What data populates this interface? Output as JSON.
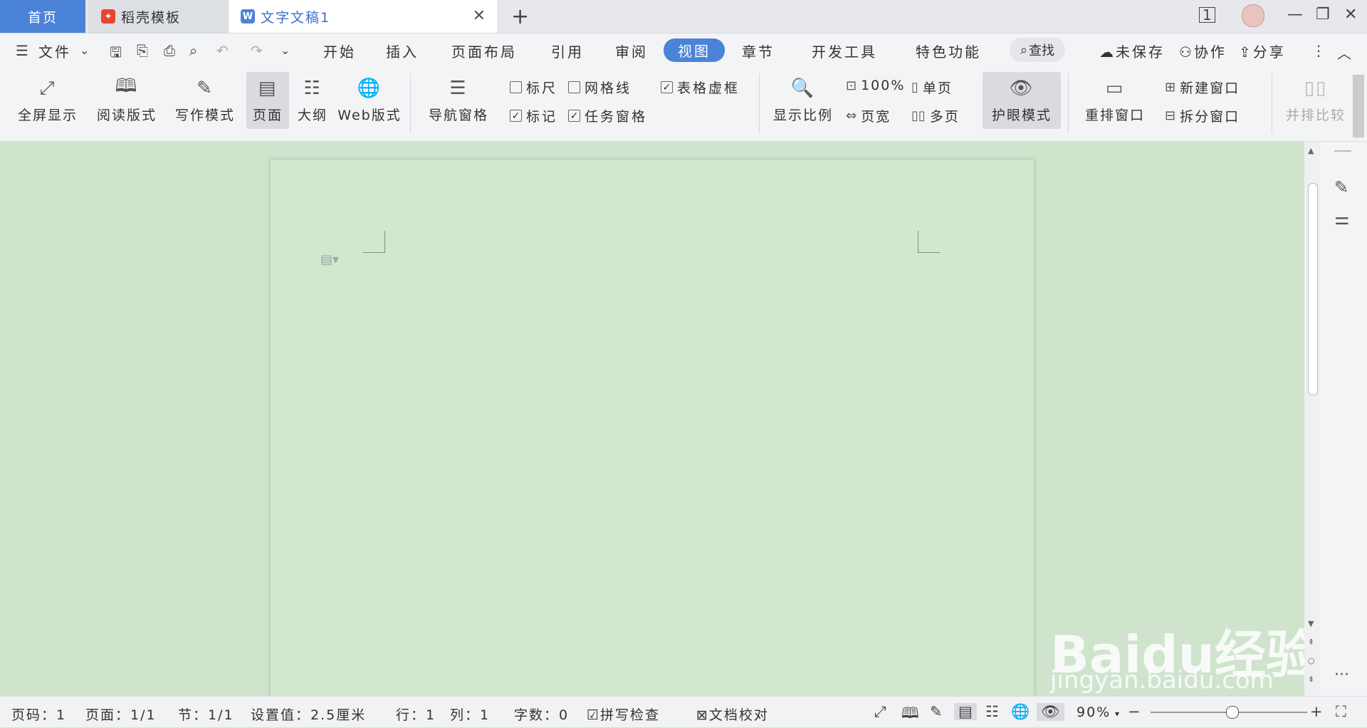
{
  "tabs": {
    "home": "首页",
    "template": "稻壳模板",
    "document": "文字文稿1"
  },
  "menu": {
    "file": "文件",
    "items": [
      "开始",
      "插入",
      "页面布局",
      "引用",
      "审阅",
      "视图",
      "章节",
      "开发工具",
      "特色功能"
    ],
    "active": "视图",
    "search": "查找",
    "unsaved": "未保存",
    "collab": "协作",
    "share": "分享"
  },
  "ribbon": {
    "fullscreen": "全屏显示",
    "reading": "阅读版式",
    "writing": "写作模式",
    "page": "页面",
    "outline": "大纲",
    "web": "Web版式",
    "nav_pane": "导航窗格",
    "ruler": "标尺",
    "gridlines": "网格线",
    "table_border": "表格虚框",
    "marks": "标记",
    "task_pane": "任务窗格",
    "zoom_ratio": "显示比例",
    "zoom100": "100%",
    "page_width": "页宽",
    "single_page": "单页",
    "multi_page": "多页",
    "eye_mode": "护眼模式",
    "rearrange": "重排窗口",
    "new_window": "新建窗口",
    "split_window": "拆分窗口",
    "side_by_side": "并排比较"
  },
  "checks": {
    "ruler": false,
    "gridlines": false,
    "table_border": true,
    "marks": true,
    "task_pane": true
  },
  "status": {
    "page_num": "页码：1",
    "pages": "页面：1/1",
    "section": "节：1/1",
    "setting": "设置值：2.5厘米",
    "row": "行：1",
    "col": "列：1",
    "words": "字数：0",
    "spell": "拼写检查",
    "proof": "文档校对",
    "zoom": "90%"
  },
  "zoom_level": 0.52,
  "watermark": {
    "brand": "Baidu经验",
    "url": "jingyan.baidu.com"
  },
  "colors": {
    "accent": "#4b83d8",
    "eye_bg": "#d0e8cd"
  }
}
